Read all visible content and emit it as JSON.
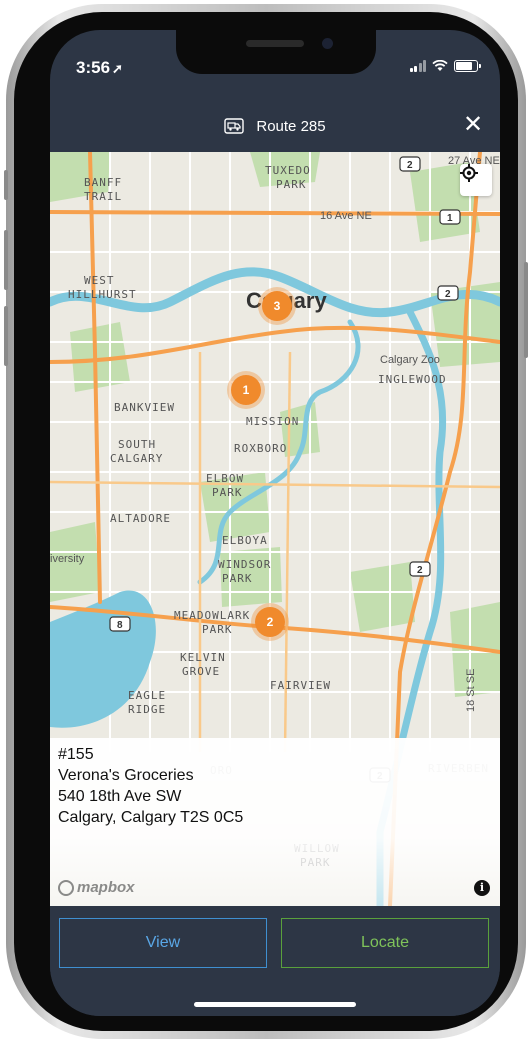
{
  "status_bar": {
    "time": "3:56"
  },
  "header": {
    "title": "Route 285",
    "close_label": "✕"
  },
  "map": {
    "place_labels": [
      "TUXEDO",
      "PARK",
      "BANFF",
      "TRAIL",
      "16 Ave NE",
      "27 Ave NE",
      "WEST",
      "HILLHURST",
      "Calgary",
      "Calgary Zoo",
      "INGLEWOOD",
      "BANKVIEW",
      "MISSION",
      "SOUTH",
      "CALGARY",
      "ROXBORO",
      "ELBOW",
      "PARK",
      "ALTADORE",
      "iversity",
      "ELBOYA",
      "WINDSOR",
      "PARK",
      "MEADOWLARK",
      "PARK",
      "KELVIN",
      "GROVE",
      "FAIRVIEW",
      "EAGLE",
      "RIDGE",
      "18 St SE",
      "ORO",
      "RIVERBEN",
      "WILLOW",
      "PARK"
    ],
    "road_shields": [
      "2",
      "1",
      "2",
      "2",
      "8",
      "2"
    ],
    "markers": [
      "3",
      "1",
      "2"
    ],
    "attribution": "mapbox",
    "info_icon": "i"
  },
  "stop": {
    "number": "#155",
    "name": "Verona's Groceries",
    "address": "540 18th Ave SW",
    "city": "Calgary, Calgary T2S 0C5"
  },
  "actions": {
    "view_label": "View",
    "locate_label": "Locate"
  },
  "colors": {
    "header_bg": "#2d3645",
    "marker": "#f08a2c",
    "view_border": "#3f8fd0",
    "locate_border": "#5aa03c",
    "river": "#7fc8dd",
    "park": "#b7d9a0",
    "road": "#f6a04d"
  },
  "icons": [
    "route-truck-icon",
    "close-icon",
    "locate-crosshair-icon",
    "location-arrow-icon",
    "signal-icon",
    "wifi-icon",
    "battery-icon",
    "info-icon"
  ]
}
